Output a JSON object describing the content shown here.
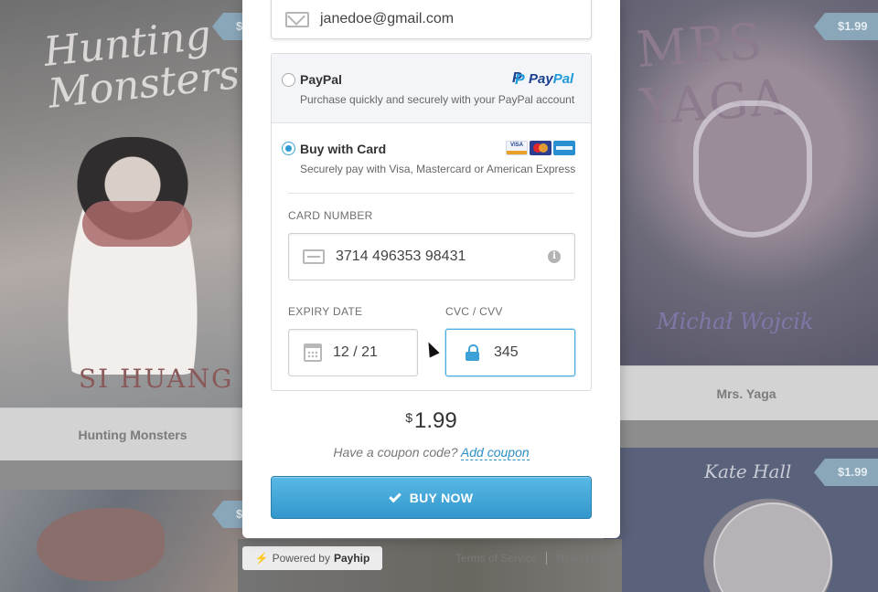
{
  "store": {
    "products": [
      {
        "name": "Hunting Monsters",
        "cover_title": "Hunting Monsters",
        "cover_author": "SI HUANG",
        "price": "$1.99"
      },
      {
        "name": "Mrs. Yaga",
        "cover_title": "MRS YAGA",
        "cover_author": "Michał Wojcik",
        "price": "$1.99"
      },
      {
        "name": "",
        "cover_title": "Kate Hall",
        "price": "$1.99"
      },
      {
        "name": "",
        "price": "$1.99"
      }
    ],
    "price_tag_partial": "$"
  },
  "checkout": {
    "email": "janedoe@gmail.com",
    "paypal": {
      "title": "PayPal",
      "subtitle": "Purchase quickly and securely with your PayPal account",
      "logo_pay": "Pay",
      "logo_pal": "Pal",
      "selected": false
    },
    "card": {
      "title": "Buy with Card",
      "subtitle": "Securely pay with Visa, Mastercard or American Express",
      "visa_label": "VISA",
      "selected": true,
      "number_label": "CARD NUMBER",
      "number_value": "3714 496353 98431",
      "info_glyph": "i",
      "expiry_label": "EXPIRY DATE",
      "expiry_value": "12 / 21",
      "cvc_label": "CVC / CVV",
      "cvc_value": "345"
    },
    "price": {
      "currency": "$",
      "amount": "1.99"
    },
    "coupon": {
      "prompt": "Have a coupon code?",
      "link": "Add coupon"
    },
    "buy_label": "BUY NOW"
  },
  "footer": {
    "powered_prefix": "Powered by",
    "powered_brand": "Payhip",
    "terms": "Terms of Service",
    "help": "Need Help?"
  },
  "colors": {
    "accent": "#3da0d6",
    "button_top": "#58b9e5",
    "button_bottom": "#3497cc",
    "overlay_bg": "#8d8d8d"
  },
  "icons": [
    "envelope-icon",
    "paypal-logo-icon",
    "visa-icon",
    "mastercard-icon",
    "amex-icon",
    "credit-card-icon",
    "info-icon",
    "calendar-icon",
    "lock-icon",
    "check-icon",
    "bolt-icon",
    "mouse-cursor-icon"
  ]
}
